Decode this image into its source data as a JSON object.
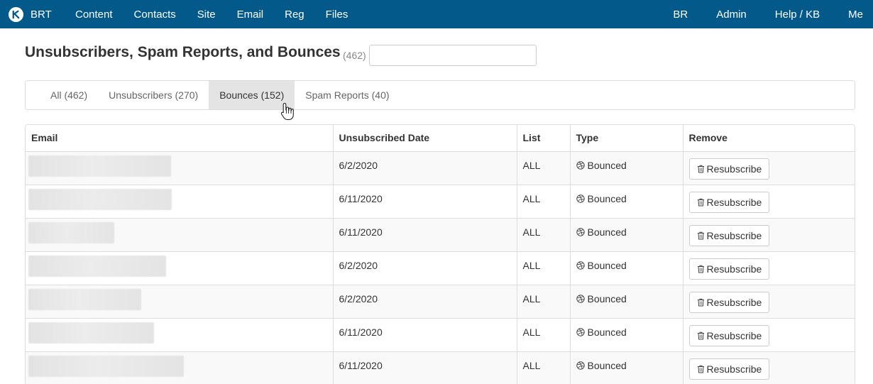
{
  "nav": {
    "brand": "BRT",
    "left_items": [
      "Content",
      "Contacts",
      "Site",
      "Email",
      "Reg",
      "Files"
    ],
    "right_items": [
      "BR",
      "Admin",
      "Help / KB",
      "Me"
    ],
    "color": "#03598a"
  },
  "header": {
    "title": "Unsubscribers, Spam Reports, and Bounces",
    "count": "(462)",
    "search_value": ""
  },
  "tabs": [
    {
      "label": "All (462)",
      "active": false
    },
    {
      "label": "Unsubscribers (270)",
      "active": false
    },
    {
      "label": "Bounces (152)",
      "active": true
    },
    {
      "label": "Spam Reports (40)",
      "active": false
    }
  ],
  "table": {
    "columns": [
      "Email",
      "Unsubscribed Date",
      "List",
      "Type",
      "Remove"
    ],
    "rows": [
      {
        "date": "6/2/2020",
        "list": "ALL",
        "type": "Bounced",
        "action": "Resubscribe"
      },
      {
        "date": "6/11/2020",
        "list": "ALL",
        "type": "Bounced",
        "action": "Resubscribe"
      },
      {
        "date": "6/11/2020",
        "list": "ALL",
        "type": "Bounced",
        "action": "Resubscribe"
      },
      {
        "date": "6/2/2020",
        "list": "ALL",
        "type": "Bounced",
        "action": "Resubscribe"
      },
      {
        "date": "6/2/2020",
        "list": "ALL",
        "type": "Bounced",
        "action": "Resubscribe"
      },
      {
        "date": "6/11/2020",
        "list": "ALL",
        "type": "Bounced",
        "action": "Resubscribe"
      },
      {
        "date": "6/11/2020",
        "list": "ALL",
        "type": "Bounced",
        "action": "Resubscribe"
      }
    ]
  },
  "icons": {
    "brand": "brt-logo-icon",
    "type": "dribbble-ball-icon",
    "remove": "trash-icon",
    "cursor": "hand-cursor-icon"
  }
}
